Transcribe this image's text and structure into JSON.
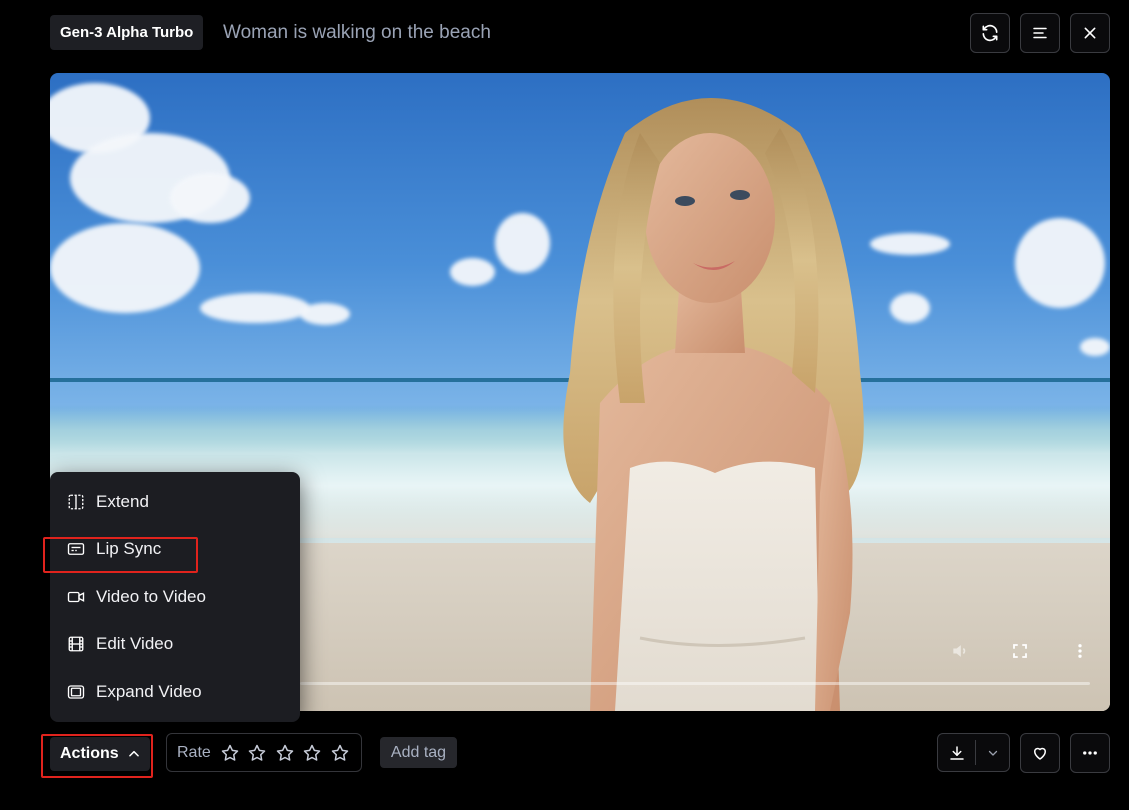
{
  "header": {
    "model_badge": "Gen-3 Alpha Turbo",
    "prompt": "Woman is walking on the beach",
    "buttons": [
      "refresh-icon",
      "menu-lines-icon",
      "close-icon"
    ]
  },
  "video": {
    "description_icons": [
      "volume-icon",
      "fullscreen-icon",
      "more-vertical-icon"
    ]
  },
  "menu": {
    "items": [
      {
        "label": "Extend",
        "icon": "extend-icon"
      },
      {
        "label": "Lip Sync",
        "icon": "lip-sync-icon",
        "highlighted": true
      },
      {
        "label": "Video to Video",
        "icon": "video-camera-icon"
      },
      {
        "label": "Edit Video",
        "icon": "film-icon"
      },
      {
        "label": "Expand Video",
        "icon": "expand-icon"
      }
    ]
  },
  "footer": {
    "actions_label": "Actions",
    "rate_label": "Rate",
    "rating": 0,
    "rating_max": 5,
    "add_tag_label": "Add tag"
  },
  "colors": {
    "highlight": "#e0231d",
    "menu_bg": "#1c1d22",
    "page_bg": "#000000"
  }
}
